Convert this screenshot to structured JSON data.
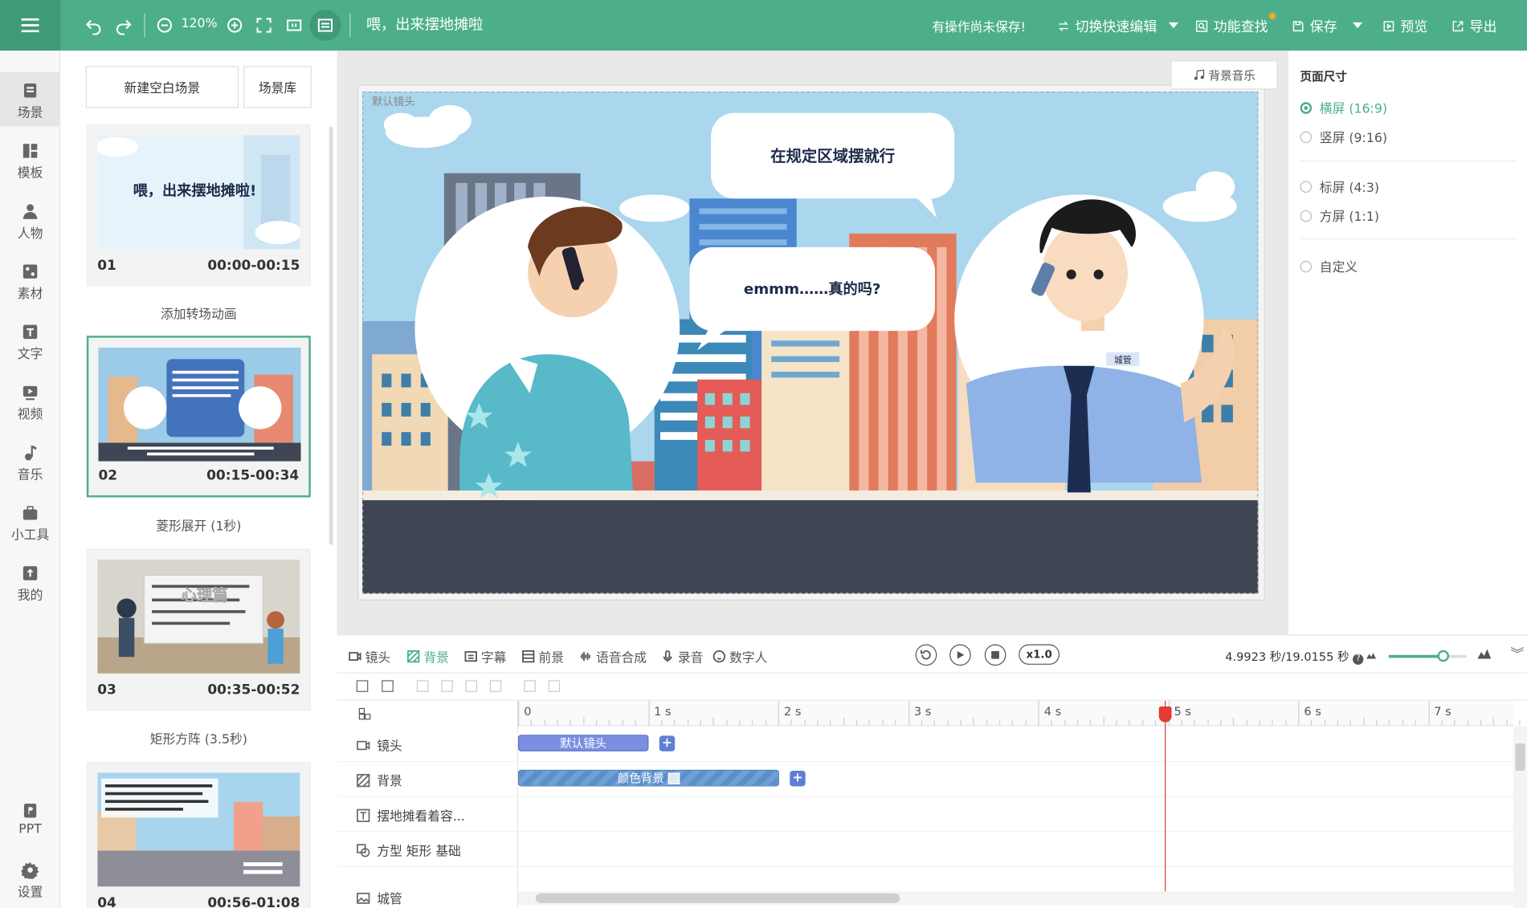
{
  "toolbar": {
    "zoom": "120%",
    "project_title": "喂，出来摆地摊啦",
    "unsaved_notice": "有操作尚未保存!",
    "quick_edit": "切换快速编辑",
    "feature_search": "功能查找",
    "save": "保存",
    "preview": "预览",
    "export": "导出"
  },
  "sidebar": {
    "items": [
      {
        "label": "场景",
        "icon": "scene-icon"
      },
      {
        "label": "模板",
        "icon": "template-icon"
      },
      {
        "label": "人物",
        "icon": "person-icon"
      },
      {
        "label": "素材",
        "icon": "material-icon"
      },
      {
        "label": "文字",
        "icon": "text-icon"
      },
      {
        "label": "视频",
        "icon": "video-icon"
      },
      {
        "label": "音乐",
        "icon": "music-icon"
      },
      {
        "label": "小工具",
        "icon": "toolbox-icon"
      },
      {
        "label": "我的",
        "icon": "upload-icon"
      },
      {
        "label": "PPT",
        "icon": "ppt-icon"
      },
      {
        "label": "设置",
        "icon": "settings-icon"
      }
    ]
  },
  "scenes_panel": {
    "new_scene": "新建空白场景",
    "scene_library": "场景库",
    "scenes": [
      {
        "num": "01",
        "time": "00:00-00:15",
        "thumb_title": "喂，出来摆地摊啦!"
      },
      {
        "num": "02",
        "time": "00:15-00:34"
      },
      {
        "num": "03",
        "time": "00:35-00:52",
        "thumb_title": "心理篇"
      },
      {
        "num": "04",
        "time": "00:56-01:08"
      }
    ],
    "transitions": [
      "添加转场动画",
      "菱形展开 (1秒)",
      "矩形方阵 (3.5秒)"
    ]
  },
  "stage": {
    "bgm": "背景音乐",
    "default_lens": "默认镜头",
    "bubble_top": "在规定区域摆就行",
    "bubble_mid": "emmm……真的吗?",
    "badge": "城管"
  },
  "props": {
    "title": "页面尺寸",
    "options": [
      {
        "label": "横屏 (16:9)",
        "selected": true
      },
      {
        "label": "竖屏 (9:16)",
        "selected": false
      },
      {
        "label": "标屏 (4:3)",
        "selected": false
      },
      {
        "label": "方屏 (1:1)",
        "selected": false
      },
      {
        "label": "自定义",
        "selected": false
      }
    ]
  },
  "timeline": {
    "tabs": [
      "镜头",
      "背景",
      "字幕",
      "前景",
      "语音合成",
      "录音",
      "数字人"
    ],
    "speed": "x1.0",
    "time_readout": "4.9923 秒/19.0155 秒",
    "zoom_fraction": 0.7,
    "ticks": [
      "0",
      "1 s",
      "2 s",
      "3 s",
      "4 s",
      "5 s",
      "6 s",
      "7 s"
    ],
    "playhead_seconds": 4.9923,
    "tracks": [
      {
        "label": "镜头",
        "icon": "camera-icon"
      },
      {
        "label": "背景",
        "icon": "background-icon"
      },
      {
        "label": "摆地摊看着容...",
        "icon": "text-box-icon"
      },
      {
        "label": "方型 矩形 基础",
        "icon": "shape-icon"
      },
      {
        "label": "城管",
        "icon": "image-icon"
      }
    ],
    "clips": {
      "lens": "默认镜头",
      "background": "颜色背景"
    }
  },
  "colors": {
    "accent": "#4caf8a",
    "clip_blue": "#7a8fe0",
    "playhead": "#e53935"
  }
}
